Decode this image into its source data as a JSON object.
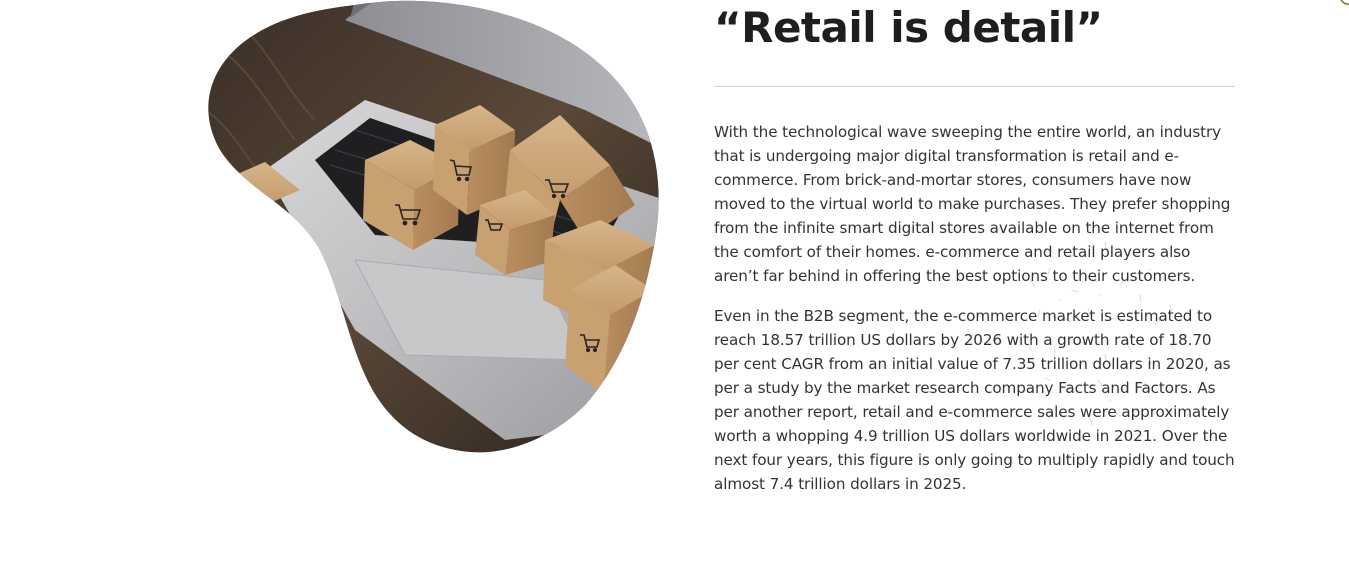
{
  "headline": "“Retail is detail”",
  "paragraphs": [
    "With the technological wave sweeping the entire world, an industry that is undergoing major digital transformation is retail and e-commerce. From brick-and-mortar stores, consumers have now moved to the virtual world to make purchases. They prefer shopping from the infinite smart digital stores available on the internet from the comfort of their homes. e-commerce and retail players also aren’t far behind in offering the best options to their customers.",
    "Even in the B2B segment, the e-commerce market is estimated to reach 18.57 trillion US dollars by 2026 with a growth rate of 18.70 per cent CAGR from an initial value of 7.35 trillion dollars in 2020, as per a study by the market research company Facts and Factors. As per another report, retail and e-commerce sales were approximately worth a whopping 4.9 trillion US dollars worldwide in 2021. Over the next four years, this figure is only going to multiply rapidly and touch almost 7.4 trillion dollars in 2025."
  ],
  "colors": {
    "text": "#333333",
    "heading": "#1e1e1e",
    "divider": "#d2d2d2",
    "confetti": "#a8d8e0"
  },
  "image_subject": "cardboard-boxes-on-laptop-keyboard",
  "icons": [
    "shopping-cart-icon"
  ]
}
